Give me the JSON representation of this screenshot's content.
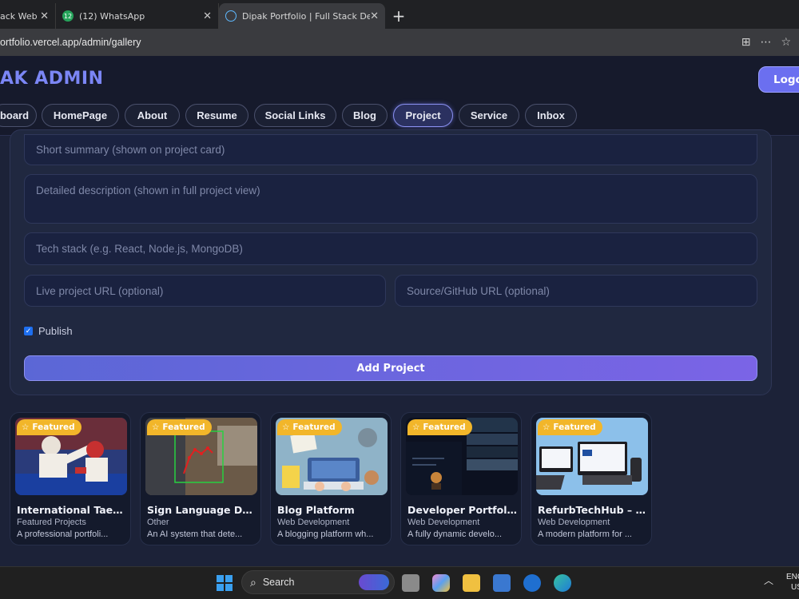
{
  "browser": {
    "tabs": [
      {
        "title": "ack Web D",
        "icon": "site-icon"
      },
      {
        "title": "(12) WhatsApp",
        "icon": "whatsapp-icon",
        "badge": "12"
      },
      {
        "title": "Dipak Portfolio | Full Stack Develop",
        "icon": "react-icon"
      }
    ],
    "url": "ortfolio.vercel.app/admin/gallery"
  },
  "header": {
    "brand": "AK ADMIN",
    "logout_label": "Logo",
    "nav": [
      "board",
      "HomePage",
      "About",
      "Resume",
      "Social Links",
      "Blog",
      "Project",
      "Service",
      "Inbox"
    ],
    "active_nav": "Project"
  },
  "form": {
    "summary_placeholder": "Short summary (shown on project card)",
    "description_placeholder": "Detailed description (shown in full project view)",
    "tech_placeholder": "Tech stack (e.g. React, Node.js, MongoDB)",
    "live_placeholder": "Live project URL (optional)",
    "source_placeholder": "Source/GitHub URL (optional)",
    "publish_label": "Publish",
    "publish_checked": true,
    "submit_label": "Add Project"
  },
  "projects": [
    {
      "badge": "Featured",
      "title": "International Taek...",
      "category": "Featured Projects",
      "desc": "A professional portfoli..."
    },
    {
      "badge": "Featured",
      "title": "Sign Language Det...",
      "category": "Other",
      "desc": "An AI system that dete..."
    },
    {
      "badge": "Featured",
      "title": "Blog Platform",
      "category": "Web Development",
      "desc": "A blogging platform wh..."
    },
    {
      "badge": "Featured",
      "title": "Developer Portfoli...",
      "category": "Web Development",
      "desc": "A fully dynamic develo..."
    },
    {
      "badge": "Featured",
      "title": "RefurbTechHub – R...",
      "category": "Web Development",
      "desc": "A modern platform for ..."
    }
  ],
  "taskbar": {
    "search_label": "Search",
    "lang_top": "ENG",
    "lang_bottom": "US"
  }
}
